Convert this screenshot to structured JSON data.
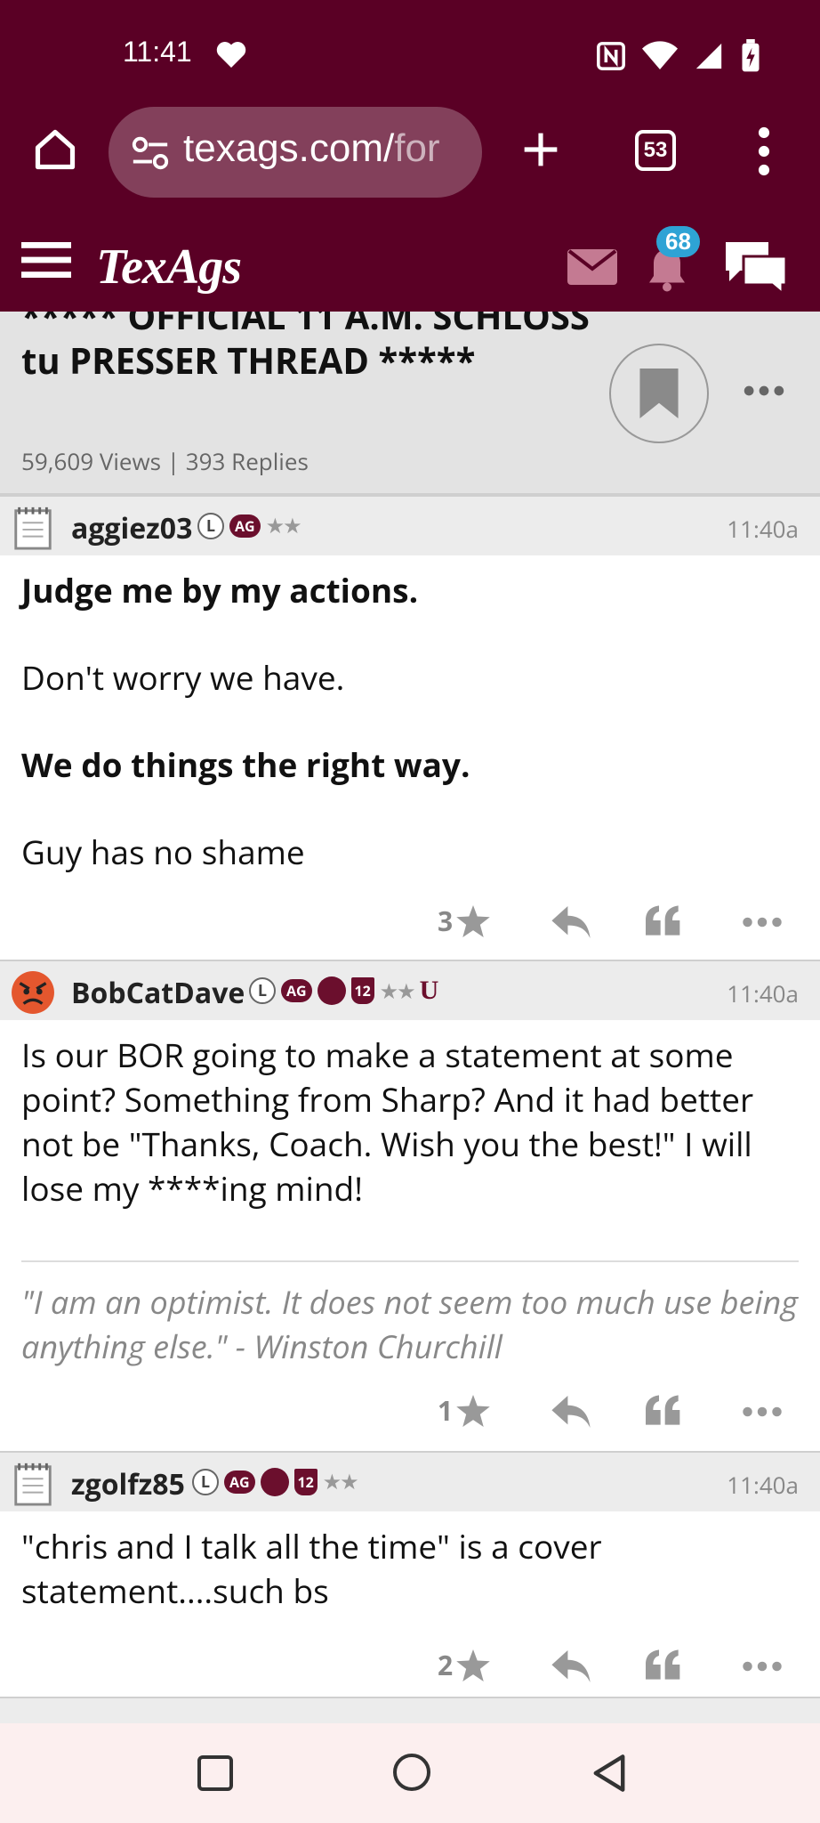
{
  "status": {
    "time": "11:41"
  },
  "browser": {
    "url_main": "texags.com/",
    "url_fade": "for",
    "tab_count": "53"
  },
  "site": {
    "logo": "TexAgs",
    "notification_count": "68"
  },
  "thread": {
    "title": "***** OFFICIAL 11 A.M. SCHLOSS tu PRESSER THREAD *****",
    "meta": "59,609 Views | 393 Replies"
  },
  "posts": [
    {
      "username": "aggiez03",
      "time": "11:40a",
      "paragraphs": [
        {
          "text": "Judge me by my actions.",
          "bold": true
        },
        {
          "text": "Don't worry we have.",
          "bold": false
        },
        {
          "text": "We do things the right way.",
          "bold": true
        },
        {
          "text": "Guy has no shame",
          "bold": false
        }
      ],
      "likes": "3"
    },
    {
      "username": "BobCatDave",
      "time": "11:40a",
      "body": "Is our BOR going to make a statement at some point? Something from Sharp? And it had better not be \"Thanks, Coach. Wish you the best!\" I will lose my ****ing mind!",
      "signature": "\"I am an optimist. It does not seem too much use being anything else.\" - Winston Churchill",
      "likes": "1"
    },
    {
      "username": "zgolfz85",
      "time": "11:40a",
      "body": "\"chris and I talk all the time\" is a cover statement....such bs",
      "likes": "2"
    }
  ],
  "badges": {
    "l": "L",
    "ag": "AG",
    "twelve": "12",
    "stars": "★★",
    "u": "U"
  }
}
